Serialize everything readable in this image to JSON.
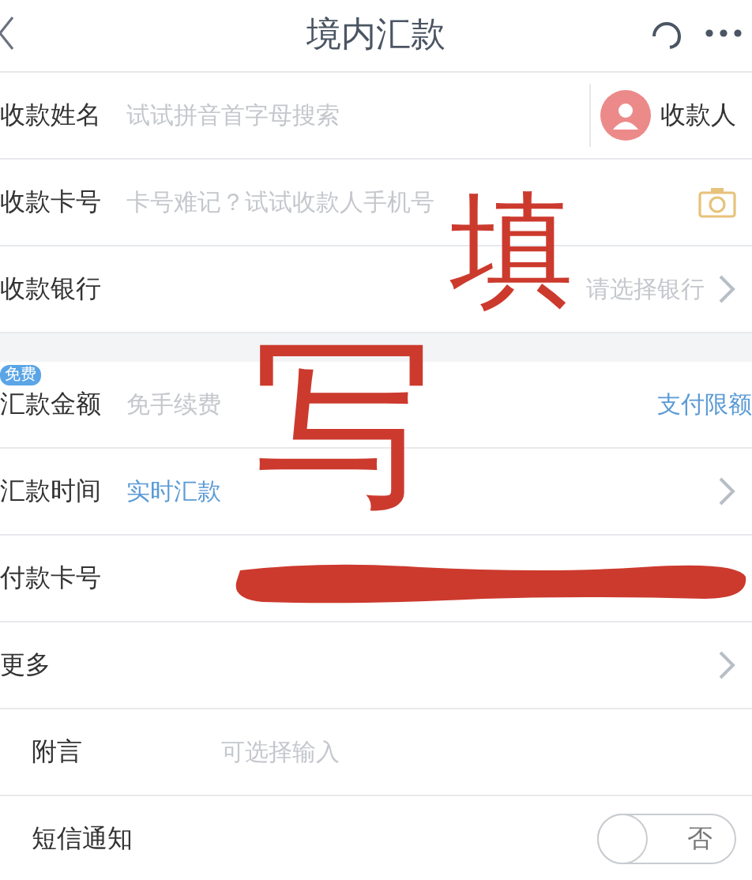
{
  "header": {
    "title": "境内汇款"
  },
  "sections": [
    [
      {
        "kind": "payee",
        "label": "收款姓名",
        "placeholder": "试试拼音首字母搜索",
        "action": "收款人"
      },
      {
        "kind": "card",
        "label": "收款卡号",
        "placeholder": "卡号难记？试试收款人手机号"
      },
      {
        "kind": "select",
        "label": "收款银行",
        "placeholder": "请选择银行"
      }
    ],
    [
      {
        "kind": "amount",
        "badge": "免费",
        "label": "汇款金额",
        "placeholder": "免手续费",
        "link": "支付限额"
      },
      {
        "kind": "select",
        "label": "汇款时间",
        "value": "实时汇款"
      },
      {
        "kind": "redacted",
        "label": "付款卡号"
      },
      {
        "kind": "select",
        "label": "更多"
      },
      {
        "kind": "input",
        "label": "附言",
        "placeholder": "可选择输入"
      },
      {
        "kind": "toggle",
        "label": "短信通知",
        "on": false,
        "state_text": "否"
      }
    ]
  ],
  "annotations": [
    {
      "text": "填"
    },
    {
      "text": "写"
    }
  ]
}
